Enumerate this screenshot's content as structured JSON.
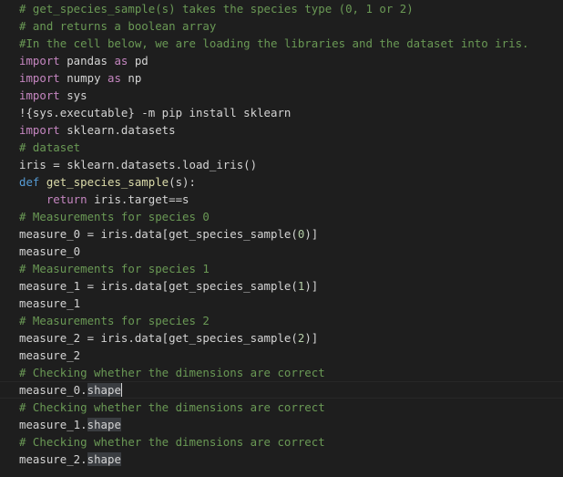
{
  "editor": {
    "lines": [
      [
        {
          "t": "comment",
          "v": "# get_species_sample(s) takes the species type (0, 1 or 2)"
        }
      ],
      [
        {
          "t": "comment",
          "v": "# and returns a boolean array"
        }
      ],
      [
        {
          "t": "comment",
          "v": "#In the cell below, we are loading the libraries and the dataset into iris."
        }
      ],
      [
        {
          "t": "keyword",
          "v": "import"
        },
        {
          "t": "var",
          "v": " pandas "
        },
        {
          "t": "keyword",
          "v": "as"
        },
        {
          "t": "var",
          "v": " pd"
        }
      ],
      [
        {
          "t": "keyword",
          "v": "import"
        },
        {
          "t": "var",
          "v": " numpy "
        },
        {
          "t": "keyword",
          "v": "as"
        },
        {
          "t": "var",
          "v": " np"
        }
      ],
      [
        {
          "t": "keyword",
          "v": "import"
        },
        {
          "t": "var",
          "v": " sys"
        }
      ],
      [
        {
          "t": "var",
          "v": "!{sys.executable} -m pip install sklearn"
        }
      ],
      [
        {
          "t": "keyword",
          "v": "import"
        },
        {
          "t": "var",
          "v": " sklearn.datasets"
        }
      ],
      [
        {
          "t": "comment",
          "v": "# dataset"
        }
      ],
      [
        {
          "t": "var",
          "v": "iris = sklearn.datasets.load_iris()"
        }
      ],
      [
        {
          "t": "def",
          "v": "def"
        },
        {
          "t": "var",
          "v": " "
        },
        {
          "t": "func",
          "v": "get_species_sample"
        },
        {
          "t": "var",
          "v": "(s):"
        }
      ],
      [
        {
          "t": "var",
          "v": "    "
        },
        {
          "t": "keyword",
          "v": "return"
        },
        {
          "t": "var",
          "v": " iris.target==s"
        }
      ],
      [
        {
          "t": "comment",
          "v": "# Measurements for species 0"
        }
      ],
      [
        {
          "t": "var",
          "v": "measure_0 = iris.data[get_species_sample("
        },
        {
          "t": "num",
          "v": "0"
        },
        {
          "t": "var",
          "v": ")]"
        }
      ],
      [
        {
          "t": "var",
          "v": "measure_0"
        }
      ],
      [
        {
          "t": "comment",
          "v": "# Measurements for species 1"
        }
      ],
      [
        {
          "t": "var",
          "v": "measure_1 = iris.data[get_species_sample("
        },
        {
          "t": "num",
          "v": "1"
        },
        {
          "t": "var",
          "v": ")]"
        }
      ],
      [
        {
          "t": "var",
          "v": "measure_1"
        }
      ],
      [
        {
          "t": "comment",
          "v": "# Measurements for species 2"
        }
      ],
      [
        {
          "t": "var",
          "v": "measure_2 = iris.data[get_species_sample("
        },
        {
          "t": "num",
          "v": "2"
        },
        {
          "t": "var",
          "v": ")]"
        }
      ],
      [
        {
          "t": "var",
          "v": "measure_2"
        }
      ],
      [
        {
          "t": "comment",
          "v": "# Checking whether the dimensions are correct"
        }
      ],
      [
        {
          "t": "var",
          "v": "measure_0."
        },
        {
          "t": "hl",
          "v": "shape"
        },
        {
          "t": "cursor",
          "v": ""
        }
      ],
      [
        {
          "t": "comment",
          "v": "# Checking whether the dimensions are correct"
        }
      ],
      [
        {
          "t": "var",
          "v": "measure_1."
        },
        {
          "t": "hl",
          "v": "shape"
        }
      ],
      [
        {
          "t": "comment",
          "v": "# Checking whether the dimensions are correct"
        }
      ],
      [
        {
          "t": "var",
          "v": "measure_2."
        },
        {
          "t": "hl",
          "v": "shape"
        }
      ]
    ]
  },
  "theme": {
    "background": "#1e1e1e",
    "text": "#d4d4d4",
    "comment": "#6a9955",
    "keyword": "#c586c0",
    "def_keyword": "#569cd6",
    "function": "#dcdcaa",
    "number": "#b5cea8",
    "selection_highlight": "#3a3d41"
  },
  "cursor_line": 22
}
